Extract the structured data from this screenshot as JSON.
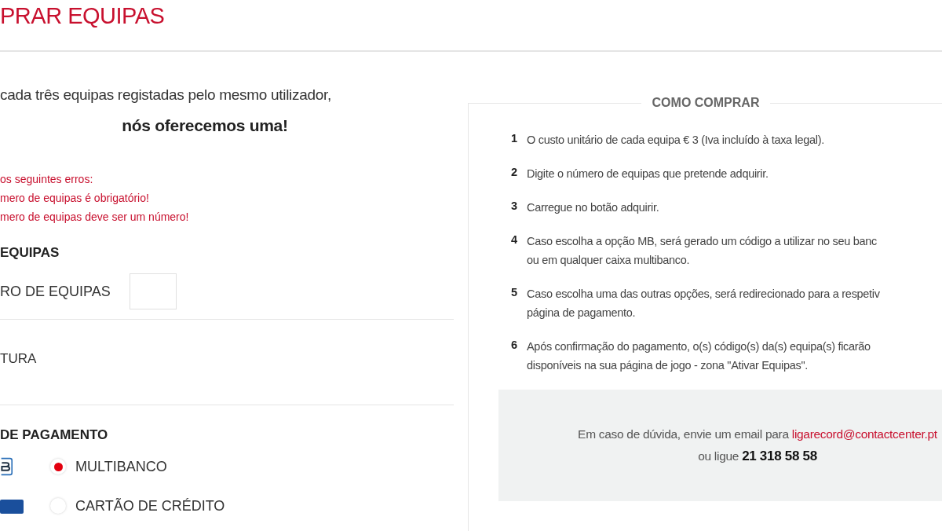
{
  "page_title": "PRAR EQUIPAS",
  "intro": {
    "line_1": "cada três equipas registadas pelo mesmo utilizador,",
    "line_2": "nós oferecemos uma!"
  },
  "errors": [
    "os seguintes erros:",
    "mero de equipas é obrigatório!",
    "mero de equipas deve ser um número!"
  ],
  "teams_section": {
    "heading": "EQUIPAS",
    "field_label": "RO DE EQUIPAS"
  },
  "invoice_label": "TURA",
  "payment": {
    "heading": "DE PAGAMENTO",
    "options": [
      {
        "kind": "mb",
        "label": "MULTIBANCO",
        "selected": true
      },
      {
        "kind": "card",
        "label": "CARTÃO DE CRÉDITO",
        "selected": false
      }
    ]
  },
  "how_to": {
    "title": "COMO COMPRAR",
    "steps": [
      {
        "number": "1",
        "lines": [
          "O custo unitário de cada equipa € 3 (Iva incluído à taxa legal)."
        ]
      },
      {
        "number": "2",
        "lines": [
          "Digite o número de equipas que pretende adquirir."
        ]
      },
      {
        "number": "3",
        "lines": [
          "Carregue no botão adquirir."
        ]
      },
      {
        "number": "4",
        "lines": [
          "Caso escolha a opção MB, será gerado um código a utilizar no seu banc",
          "ou em qualquer caixa multibanco."
        ]
      },
      {
        "number": "5",
        "lines": [
          "Caso escolha uma das outras opções, será redirecionado para a respetiv",
          "página de pagamento."
        ]
      },
      {
        "number": "6",
        "lines": [
          "Após confirmação do pagamento, o(s) código(s) da(s) equipa(s) ficarão",
          "disponíveis na sua página de jogo - zona \"Ativar Equipas\"."
        ]
      }
    ],
    "contact": {
      "text": "Em caso de dúvida, envie um email para",
      "email": "ligarecord@contactcenter.pt",
      "phone_prefix": "ou ligue",
      "phone": "21 318 58 58"
    }
  }
}
